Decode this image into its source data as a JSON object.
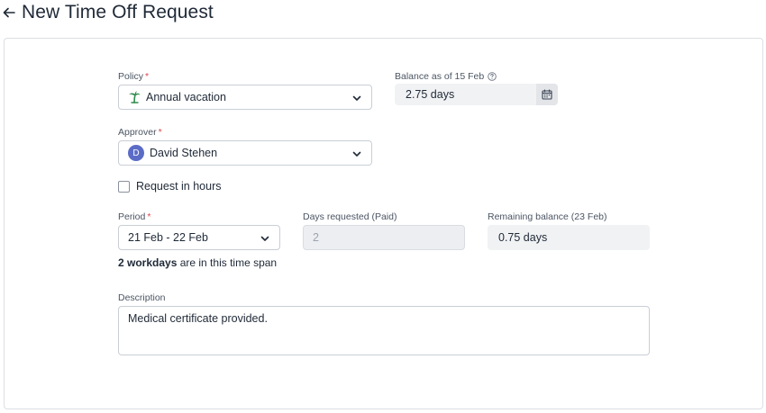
{
  "header": {
    "title": "New Time Off Request"
  },
  "form": {
    "policy": {
      "label": "Policy",
      "required_mark": "*",
      "value": "Annual vacation"
    },
    "balance": {
      "label": "Balance as of 15 Feb",
      "value": "2.75 days"
    },
    "approver": {
      "label": "Approver",
      "required_mark": "*",
      "avatar_initial": "D",
      "value": "David Stehen"
    },
    "request_in_hours": {
      "label": "Request in hours",
      "checked": false
    },
    "period": {
      "label": "Period",
      "required_mark": "*",
      "value": "21 Feb - 22 Feb"
    },
    "workdays_note": {
      "bold": "2 workdays",
      "rest": " are in this time span"
    },
    "days_requested": {
      "label": "Days requested (Paid)",
      "value": "2"
    },
    "remaining_balance": {
      "label": "Remaining balance (23 Feb)",
      "value": "0.75 days"
    },
    "description": {
      "label": "Description",
      "value": "Medical certificate provided."
    }
  },
  "colors": {
    "required": "#e0464c",
    "avatar": "#5b6cc7",
    "palm_icon": "#2f8a4a"
  }
}
